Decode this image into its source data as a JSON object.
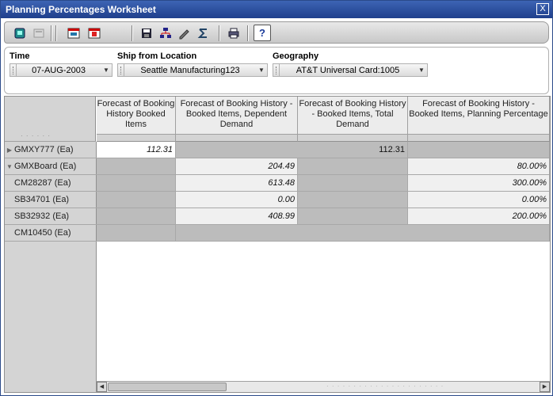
{
  "window": {
    "title": "Planning Percentages Worksheet",
    "close_label": "X"
  },
  "toolbar": {
    "buttons": [
      {
        "name": "open-icon"
      },
      {
        "name": "document-icon"
      },
      {
        "name": "calendar-icon"
      },
      {
        "name": "calendar-red-icon"
      },
      {
        "name": "save-icon"
      },
      {
        "name": "hierarchy-icon"
      },
      {
        "name": "pencil-icon"
      },
      {
        "name": "sum-icon"
      },
      {
        "name": "print-icon"
      },
      {
        "name": "help-icon",
        "label": "?"
      }
    ]
  },
  "filters": {
    "time": {
      "label": "Time",
      "value": "07-AUG-2003"
    },
    "ship_from": {
      "label": "Ship from Location",
      "value": "Seattle Manufacturing123"
    },
    "geography": {
      "label": "Geography",
      "value": "AT&T Universal Card:1005"
    }
  },
  "grid": {
    "columns": [
      "Forecast of Booking History Booked Items",
      "Forecast of Booking History - Booked Items, Dependent Demand",
      "Forecast of Booking History - Booked Items, Total Demand",
      "Forecast of Booking History - Booked Items, Planning Percentage"
    ],
    "rows": [
      {
        "label": "GMXY777 (Ea)",
        "toggle": "▶",
        "values": [
          "112.31",
          "",
          "112.31",
          ""
        ]
      },
      {
        "label": "GMXBoard (Ea)",
        "toggle": "▼",
        "values": [
          "",
          "204.49",
          "",
          "80.00%"
        ]
      },
      {
        "label": "CM28287 (Ea)",
        "toggle": "",
        "values": [
          "",
          "613.48",
          "",
          "300.00%"
        ]
      },
      {
        "label": "SB34701 (Ea)",
        "toggle": "",
        "values": [
          "",
          "0.00",
          "",
          "0.00%"
        ]
      },
      {
        "label": "SB32932 (Ea)",
        "toggle": "",
        "values": [
          "",
          "408.99",
          "",
          "200.00%"
        ]
      },
      {
        "label": "CM10450 (Ea)",
        "toggle": "",
        "values": [
          "",
          "",
          "",
          ""
        ]
      }
    ]
  },
  "scrollbar": {
    "left_arrow": "◀",
    "right_arrow": "▶"
  }
}
